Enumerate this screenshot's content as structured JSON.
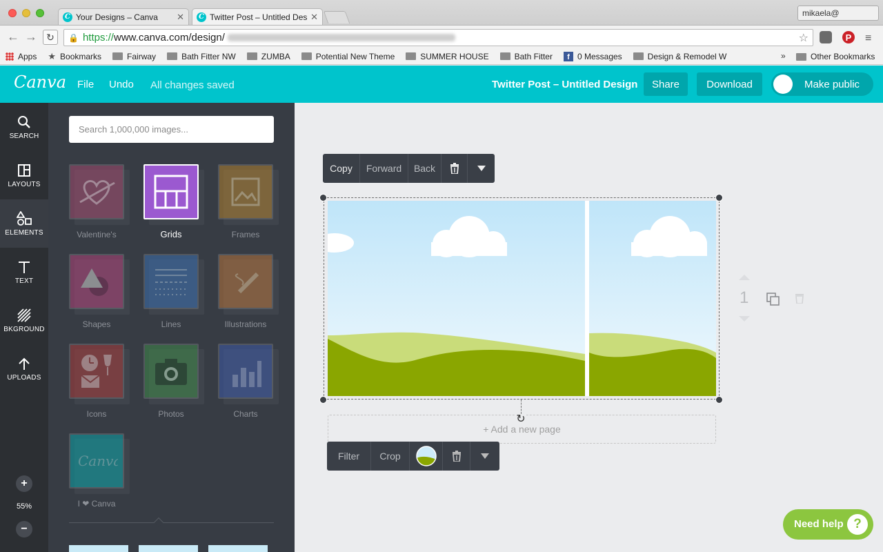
{
  "browser": {
    "tabs": [
      {
        "title": "Your Designs – Canva"
      },
      {
        "title": "Twitter Post – Untitled Des"
      }
    ],
    "profile": "mikaela@",
    "url": {
      "scheme": "https://",
      "domain": "www.canva.com/design/"
    },
    "bookmarks": [
      {
        "label": "Apps",
        "icon": "apps-icon"
      },
      {
        "label": "Bookmarks",
        "icon": "star-icon"
      },
      {
        "label": "Fairway",
        "icon": "folder-icon"
      },
      {
        "label": "Bath Fitter NW",
        "icon": "folder-icon"
      },
      {
        "label": "ZUMBA",
        "icon": "folder-icon"
      },
      {
        "label": "Potential New Theme",
        "icon": "folder-icon"
      },
      {
        "label": "SUMMER HOUSE",
        "icon": "folder-icon"
      },
      {
        "label": "Bath Fitter",
        "icon": "folder-icon"
      },
      {
        "label": "0 Messages",
        "icon": "facebook-icon"
      },
      {
        "label": "Design & Remodel W",
        "icon": "folder-icon"
      }
    ],
    "bookmarks_more": "»",
    "other_bookmarks": "Other Bookmarks"
  },
  "header": {
    "logo": "Canva",
    "file": "File",
    "undo": "Undo",
    "saved": "All changes saved",
    "title": "Twitter Post – Untitled Design",
    "share": "Share",
    "download": "Download",
    "make_public": "Make public"
  },
  "rail": {
    "items": [
      {
        "label": "SEARCH",
        "icon": "search-icon"
      },
      {
        "label": "LAYOUTS",
        "icon": "layouts-icon"
      },
      {
        "label": "ELEMENTS",
        "icon": "elements-icon"
      },
      {
        "label": "TEXT",
        "icon": "text-icon"
      },
      {
        "label": "BKGROUND",
        "icon": "background-icon"
      },
      {
        "label": "UPLOADS",
        "icon": "upload-icon"
      }
    ],
    "active": "ELEMENTS",
    "zoom": "55%",
    "zoom_in": "+",
    "zoom_out": "−"
  },
  "panel": {
    "search_placeholder": "Search 1,000,000 images...",
    "tiles": [
      {
        "label": "Valentine's",
        "color": "#a24a6e"
      },
      {
        "label": "Grids",
        "color": "#9b59d0"
      },
      {
        "label": "Frames",
        "color": "#b08030"
      },
      {
        "label": "Shapes",
        "color": "#b0437a"
      },
      {
        "label": "Lines",
        "color": "#3b6fb0"
      },
      {
        "label": "Illustrations",
        "color": "#b6743c"
      },
      {
        "label": "Icons",
        "color": "#a83b3b"
      },
      {
        "label": "Photos",
        "color": "#3f8a4a"
      },
      {
        "label": "Charts",
        "color": "#3e5aa8"
      },
      {
        "label": "I ❤ Canva",
        "color": "#0aa3a8"
      }
    ],
    "active": "Grids"
  },
  "canvas": {
    "top_bar": {
      "copy": "Copy",
      "forward": "Forward",
      "back": "Back"
    },
    "bottom_bar": {
      "filter": "Filter",
      "crop": "Crop"
    },
    "add_page": "+ Add a new page",
    "page_number": "1",
    "help": "Need help",
    "help_q": "?"
  },
  "colors": {
    "brand": "#00c4cc",
    "help": "#8cc63f",
    "sky": "#cdebf9",
    "hill_light": "#c9dc7a",
    "hill_dark": "#8aa600"
  }
}
